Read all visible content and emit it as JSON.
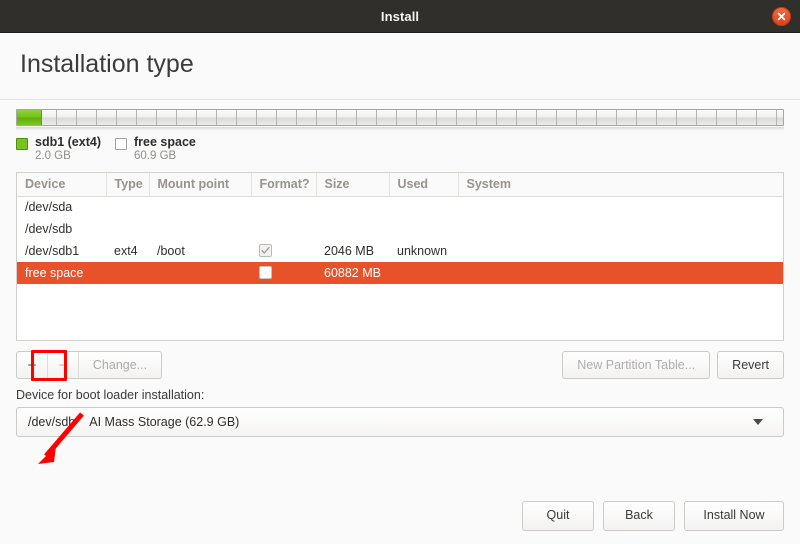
{
  "window": {
    "title": "Install",
    "close_icon": "close-icon",
    "close_color": "#e8522a"
  },
  "page": {
    "title": "Installation type"
  },
  "partition_bar": {
    "segments": [
      {
        "label": "sdb1 (ext4)",
        "size": "2.0 GB",
        "color": "#77c421",
        "percent": 3.2
      },
      {
        "label": "free space",
        "size": "60.9 GB",
        "color": "#ffffff",
        "percent": 96.8
      }
    ]
  },
  "table": {
    "columns": [
      "Device",
      "Type",
      "Mount point",
      "Format?",
      "Size",
      "Used",
      "System"
    ],
    "rows": [
      {
        "device": "/dev/sda",
        "type": "",
        "mount": "",
        "format": "none",
        "size": "",
        "used": "",
        "system": "",
        "indent": 0,
        "selected": false
      },
      {
        "device": "/dev/sdb",
        "type": "",
        "mount": "",
        "format": "none",
        "size": "",
        "used": "",
        "system": "",
        "indent": 0,
        "selected": false
      },
      {
        "device": "/dev/sdb1",
        "type": "ext4",
        "mount": "/boot",
        "format": "checked-disabled",
        "size": "2046 MB",
        "used": "unknown",
        "system": "",
        "indent": 1,
        "selected": false
      },
      {
        "device": "free space",
        "type": "",
        "mount": "",
        "format": "unchecked",
        "size": "60882 MB",
        "used": "",
        "system": "",
        "indent": 1,
        "selected": true
      }
    ]
  },
  "actions": {
    "add_label": "+",
    "remove_label": "−",
    "change_label": "Change...",
    "new_partition_table_label": "New Partition Table...",
    "revert_label": "Revert"
  },
  "annotation": {
    "arrow_color": "#ff0000",
    "highlight_target": "add-partition-button",
    "highlight_color": "#ff0000"
  },
  "bootloader": {
    "label": "Device for boot loader installation:",
    "selected_device": "/dev/sdb",
    "selected_description": "AI Mass Storage (62.9 GB)",
    "arrow_icon": "chevron-down-icon"
  },
  "footer": {
    "quit_label": "Quit",
    "back_label": "Back",
    "install_label": "Install Now"
  }
}
